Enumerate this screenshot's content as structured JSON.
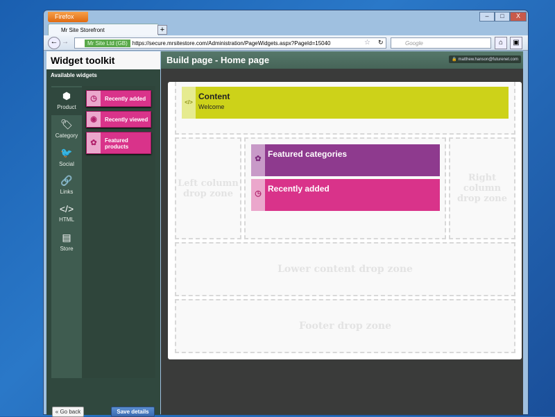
{
  "browser": {
    "menu_button": "Firefox",
    "tab_title": "Mr Site Storefront",
    "new_tab": "+",
    "identity": "Mr Site Ltd (GB)",
    "url": "https://secure.mrsitestore.com/Administration/PageWidgets.aspx?PageId=15040",
    "search_placeholder": "Google",
    "window_controls": [
      "–",
      "□",
      "X"
    ]
  },
  "sidebar": {
    "title": "Widget toolkit",
    "subtitle": "Available widgets",
    "categories": [
      {
        "label": "Product",
        "icon": "box-icon",
        "glyph": "⬢"
      },
      {
        "label": "Category",
        "icon": "tag-icon",
        "glyph": "🏷"
      },
      {
        "label": "Social",
        "icon": "twitter-bird-icon",
        "glyph": "🐦"
      },
      {
        "label": "Links",
        "icon": "chain-link-icon",
        "glyph": "🔗"
      },
      {
        "label": "HTML",
        "icon": "code-icon",
        "glyph": "</>"
      },
      {
        "label": "Store",
        "icon": "store-card-icon",
        "glyph": "▤"
      }
    ],
    "widgets": [
      {
        "label": "Recently added",
        "icon": "clock-icon",
        "glyph": "◷"
      },
      {
        "label": "Recently viewed",
        "icon": "eye-icon",
        "glyph": "◉"
      },
      {
        "label": "Featured products",
        "icon": "award-icon",
        "glyph": "✿"
      }
    ],
    "back_button": "« Go back",
    "save_button": "Save details"
  },
  "main": {
    "title": "Build page - Home page",
    "user": "matthew.hanson@futurenet.com",
    "content_widget": {
      "title": "Content",
      "subtitle": "Welcome",
      "glyph": "</>"
    },
    "center_widgets": [
      {
        "label": "Featured categories",
        "glyph": "✿",
        "color": "#8e3a8e"
      },
      {
        "label": "Recently added",
        "glyph": "◷",
        "color": "#d9338a"
      }
    ],
    "zones": {
      "left": "Left column drop zone",
      "right": "Right column drop zone",
      "lower": "Lower content drop zone",
      "footer": "Footer drop zone"
    }
  },
  "colors": {
    "accent_pink": "#d9338a",
    "content_yellow": "#cdd219",
    "sidebar_green": "#30483e"
  }
}
